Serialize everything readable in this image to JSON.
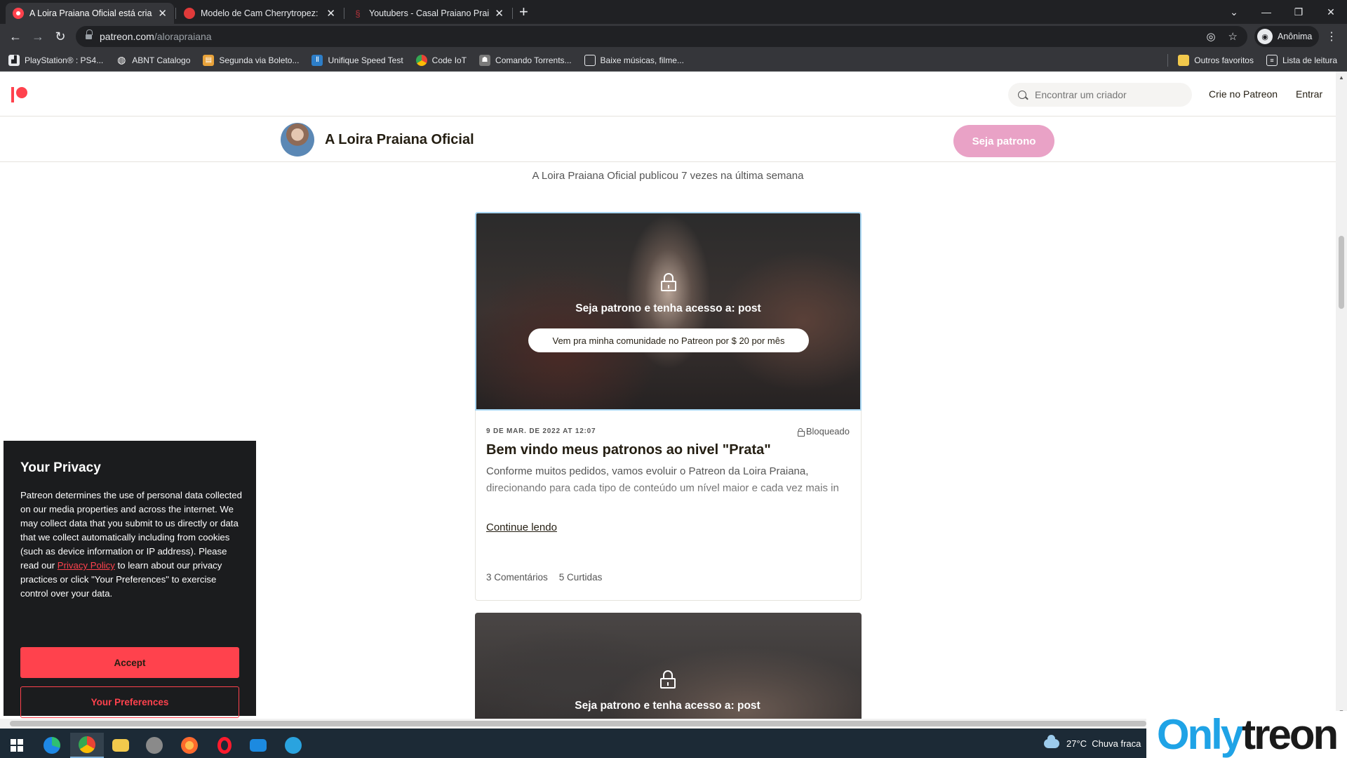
{
  "browser": {
    "tabs": [
      {
        "title": "A Loira Praiana Oficial está criando",
        "favicon_color": "#ff424d"
      },
      {
        "title": "Modelo de Cam Cherrytropez: Sh",
        "favicon_color": "#e03a3a"
      },
      {
        "title": "Youtubers - Casal Praiano Praiana",
        "favicon_color": "#b3323a"
      }
    ],
    "url_host": "patreon.com",
    "url_path": "/alorapraiana",
    "profile_label": "Anônima",
    "bookmarks": [
      {
        "label": "PlayStation® : PS4...",
        "icon": "playstation-icon"
      },
      {
        "label": "ABNT Catalogo",
        "icon": "globe-icon"
      },
      {
        "label": "Segunda via Boleto...",
        "icon": "document-icon"
      },
      {
        "label": "Unifique Speed Test",
        "icon": "speedtest-icon"
      },
      {
        "label": "Code IoT",
        "icon": "chrome-icon"
      },
      {
        "label": "Comando Torrents...",
        "icon": "torrent-icon"
      },
      {
        "label": "Baixe músicas, filme...",
        "icon": "monitor-icon"
      }
    ],
    "other_bookmarks": "Outros favoritos",
    "reading_list": "Lista de leitura"
  },
  "patreon": {
    "search_placeholder": "Encontrar um criador",
    "create_link": "Crie no Patreon",
    "login_link": "Entrar",
    "creator_name": "A Loira Praiana Oficial",
    "join_button": "Seja patrono",
    "posted_note": "A Loira Praiana Oficial publicou 7 vezes na última semana",
    "posts": [
      {
        "lock_text": "Seja patrono e tenha acesso a: post",
        "tier_pill": "Vem pra minha comunidade no Patreon por $ 20 por mês",
        "date": "9 DE MAR. DE 2022 AT 12:07",
        "status": "Bloqueado",
        "title": "Bem vindo meus patronos ao nivel \"Prata\"",
        "excerpt": "Conforme muitos pedidos, vamos evoluir o Patreon da Loira Praiana, direcionando para cada tipo de conteúdo um nível maior e cada vez mais in",
        "continue": "Continue lendo",
        "comments": "3 Comentários",
        "likes": "5 Curtidas"
      },
      {
        "lock_text": "Seja patrono e tenha acesso a: post"
      }
    ]
  },
  "privacy": {
    "title": "Your Privacy",
    "body_before": "Patreon determines the use of personal data collected on our media properties and across the internet. We may collect data that you submit to us directly or data that we collect automatically including from cookies (such as device information or IP address). Please read our ",
    "link": "Privacy Policy",
    "body_after": " to learn about our privacy practices or click \"Your Preferences\" to exercise control over your data.",
    "accept": "Accept",
    "preferences": "Your Preferences"
  },
  "taskbar": {
    "weather": "27°C  Chuva fraca"
  },
  "watermark": {
    "part1": "Only",
    "part2": "treon"
  },
  "colors": {
    "patreon_coral": "#ff424d",
    "join_pink": "#e9a2c6",
    "chrome_dark": "#202124"
  }
}
